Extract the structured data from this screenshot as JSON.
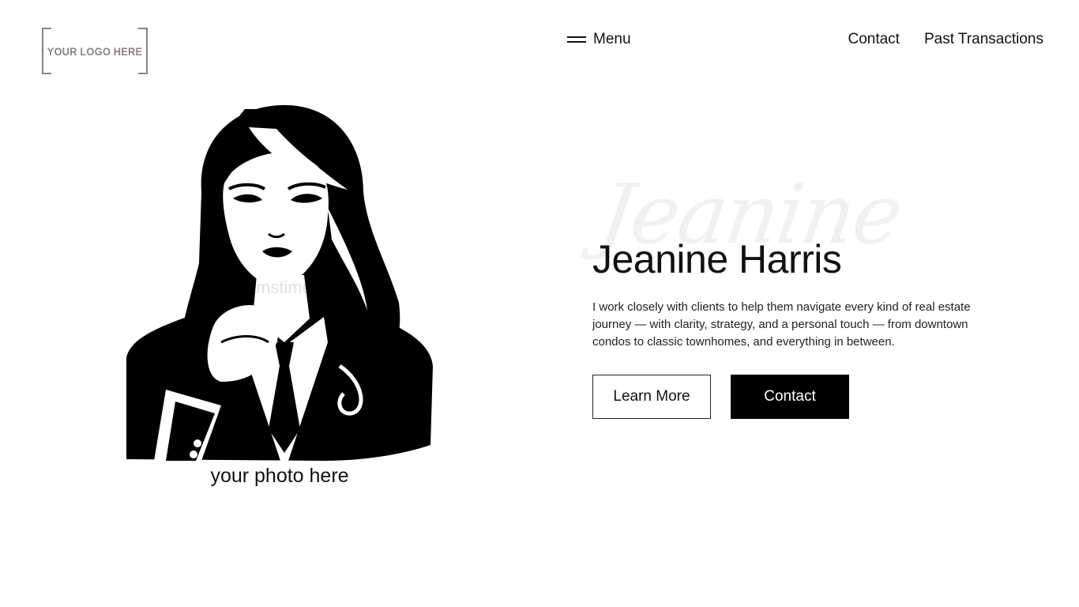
{
  "header": {
    "logo_text": "YOUR LOGO HERE",
    "menu_label": "Menu",
    "nav": [
      {
        "label": "Contact"
      },
      {
        "label": "Past Transactions"
      }
    ]
  },
  "hero": {
    "photo_caption": "your photo here",
    "photo_watermark": "dreamstime",
    "script_name": "Jeanine",
    "title": "Jeanine Harris",
    "description": "I work closely with clients to help them navigate every kind of real estate journey — with clarity, strategy, and a personal touch — from downtown condos to classic townhomes, and everything in between.",
    "learn_more_label": "Learn More",
    "contact_label": "Contact"
  },
  "colors": {
    "background": "#ffffff",
    "text": "#111111",
    "button_solid": "#000000",
    "logo_grey": "#8a8287"
  },
  "icons": {
    "menu": "hamburger-icon"
  }
}
